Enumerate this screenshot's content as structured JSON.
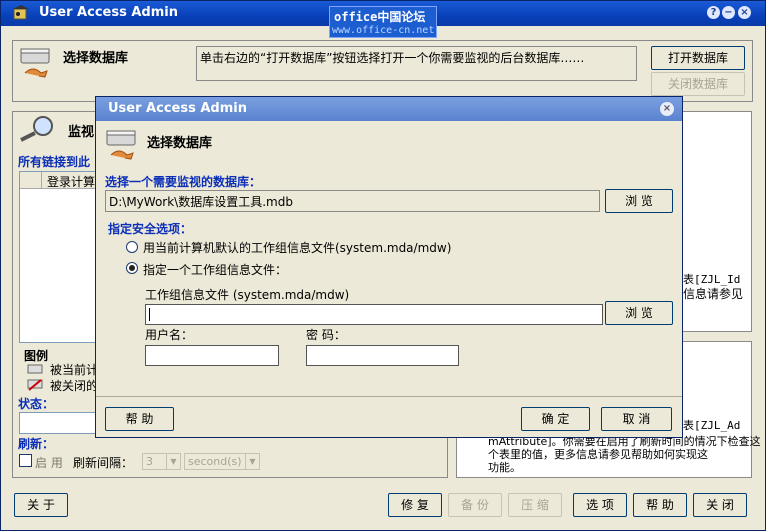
{
  "app": {
    "title": "User Access Admin",
    "watermark_line1": "office中国论坛",
    "watermark_line2": "www.office-cn.net",
    "title_buttons": [
      "?",
      "−",
      "×"
    ]
  },
  "db_section": {
    "title": "选择数据库",
    "hint": "单击右边的“打开数据库”按钮选择打开一个你需要监视的后台数据库……",
    "open_button": "打开数据库",
    "close_button": "关闭数据库"
  },
  "monitor_section": {
    "title_partial": "监视",
    "subtitle_partial": "所有链接到此",
    "column_header_partial": "登录计算"
  },
  "legend": {
    "title": "图例",
    "item1_partial": "被当前计",
    "item2_partial": "被关闭的"
  },
  "status": {
    "label": "状态："
  },
  "refresh": {
    "label": "刷新：",
    "enable_label": "启 用",
    "interval_label": "刷新间隔：",
    "interval_value": "3",
    "unit_value": "second(s)"
  },
  "right_panel": {
    "upper_line1": "表[ZJL_Id",
    "upper_line2": "信息请参见",
    "lower_line1": "表[ZJL_Ad",
    "lower_line2": "mAttribute]。你需要在启用了刷新时间的情况下检查这",
    "lower_line3": "个表里的值，更多信息请参见帮助如何实现这",
    "lower_line4": "功能。"
  },
  "bottom_buttons": {
    "about": "关 于",
    "repair": "修 复",
    "backup": "备 份",
    "compact": "压 缩",
    "options": "选 项",
    "help": "帮 助",
    "close": "关 闭"
  },
  "dialog": {
    "title": "User Access Admin",
    "header": "选择数据库",
    "select_label": "选择一个需要监视的数据库：",
    "db_path": "D:\\MyWork\\数据库设置工具.mdb",
    "browse1": "浏 览",
    "security_label": "指定安全选项：",
    "radio1": "用当前计算机默认的工作组信息文件(system.mda/mdw)",
    "radio2": "指定一个工作组信息文件：",
    "workgroup_label": "工作组信息文件 (system.mda/mdw)",
    "workgroup_value": "",
    "browse2": "浏 览",
    "username_label": "用户名：",
    "password_label": "密 码：",
    "username_value": "",
    "password_value": "",
    "help_button": "帮 助",
    "ok_button": "确 定",
    "cancel_button": "取 消"
  }
}
